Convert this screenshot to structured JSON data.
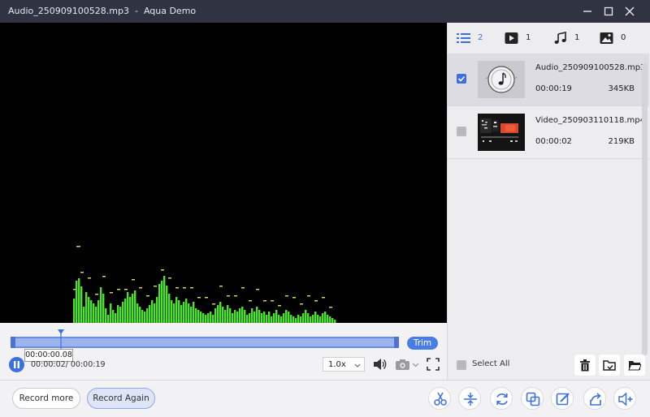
{
  "window": {
    "file_name": "Audio_250909100528.mp3",
    "separator": "-",
    "app_name": "Aqua Demo"
  },
  "player": {
    "tooltip_time": "00:00:00.08",
    "current_time": "00:00:02/ 00:00:19",
    "trim_label": "Trim",
    "speed": "1.0x",
    "playhead_fraction": 0.12
  },
  "tabs": [
    {
      "icon": "list-icon",
      "count": "2"
    },
    {
      "icon": "video-icon",
      "count": "1"
    },
    {
      "icon": "music-note-icon",
      "count": "1"
    },
    {
      "icon": "image-icon",
      "count": "0"
    }
  ],
  "files": [
    {
      "name": "Audio_250909100528.mp3",
      "duration": "00:00:19",
      "size": "345KB",
      "selected": true,
      "type": "audio"
    },
    {
      "name": "Video_250903110118.mp4",
      "duration": "00:00:02",
      "size": "219KB",
      "selected": false,
      "type": "video"
    }
  ],
  "panel": {
    "select_all_label": "Select All"
  },
  "buttons": {
    "record_more": "Record more",
    "record_again": "Record Again"
  },
  "colors": {
    "accent": "#3d6fe0",
    "titlebar": "#2f3342",
    "spectrum_green": "#4fe02a",
    "spectrum_peak": "#d6d24a"
  }
}
